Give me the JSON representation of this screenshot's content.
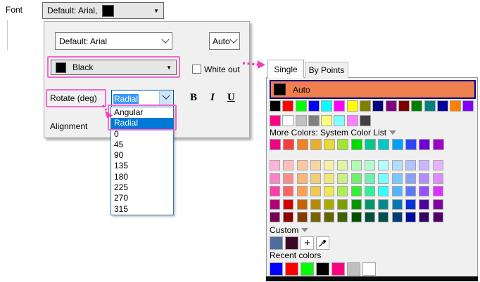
{
  "font_label": "Font",
  "top_dropdown": {
    "text": "Default: Arial,",
    "swatch": "#000000"
  },
  "font_panel": {
    "font_combo": "Default: Arial",
    "size_combo": "Auto",
    "color_combo": "Black",
    "color_swatch": "#000000",
    "white_out_label": "White out",
    "rotate_label": "Rotate (deg)",
    "rotate_value": "Radial",
    "bold_label": "B",
    "italic_label": "I",
    "underline_label": "U",
    "alignment_label": "Alignment"
  },
  "rotate_list": {
    "items": [
      "Angular",
      "Radial",
      "0",
      "45",
      "90",
      "135",
      "180",
      "225",
      "270",
      "315"
    ],
    "selected": "Radial"
  },
  "color_picker": {
    "tab_single": "Single",
    "tab_by_points": "By Points",
    "auto_label": "Auto",
    "auto_bg": "#F08050",
    "auto_swatch": "#000000",
    "basic_row1": [
      "#000000",
      "#FF0000",
      "#00FF00",
      "#0000FF",
      "#00FFFF",
      "#FF00FF",
      "#FFFF00",
      "#808000",
      "#000080",
      "#800080",
      "#800000",
      "#008000",
      "#008080",
      "#0000A0",
      "#FF8000",
      "#8000FF"
    ],
    "basic_row2": [
      "#FF0080",
      "#FFFFFF",
      "#C0C0C0",
      "#808080",
      "#FFFF80",
      "#80FFFF",
      "#FF80FF",
      "#404040"
    ],
    "more_colors_label": "More Colors: System Color List",
    "system_rows": [
      [
        "#F00082",
        "#FA3C3C",
        "#F08228",
        "#E6AF2D",
        "#E6DC32",
        "#A0E632",
        "#00DC00",
        "#00C78C",
        "#00C8C8",
        "#00A0FF",
        "#2846FF",
        "#6E00DC",
        "#A000C8"
      ],
      [
        "#FFB4DC",
        "#FFBEBE",
        "#FAC8A0",
        "#F5D7A5",
        "#F5F0AA",
        "#DCF5AA",
        "#B4FAB4",
        "#B4FAD2",
        "#B4FFFF",
        "#B4DCFF",
        "#B4C3FF",
        "#CCB4FF",
        "#E6B4FF"
      ],
      [
        "#FF82C8",
        "#FF8C8C",
        "#FFB478",
        "#F0CD78",
        "#F0E678",
        "#C8F082",
        "#6EF06E",
        "#6EF0B4",
        "#78FFFF",
        "#78C8FF",
        "#8CA0FF",
        "#B48CFF",
        "#DC8CFF"
      ],
      [
        "#FF3CAA",
        "#FF6464",
        "#FFA050",
        "#F0C850",
        "#F0E650",
        "#AAF050",
        "#32F032",
        "#32F0A0",
        "#32FFFF",
        "#50B4FF",
        "#5A78FF",
        "#9650FF",
        "#DC32FF"
      ],
      [
        "#B40078",
        "#D20000",
        "#C86400",
        "#B48C00",
        "#AAAA00",
        "#78A000",
        "#009600",
        "#00966E",
        "#008C8C",
        "#0078B4",
        "#0032DC",
        "#5000A0",
        "#8200A0"
      ],
      [
        "#780050",
        "#8C0000",
        "#823C00",
        "#786400",
        "#646400",
        "#3C6400",
        "#005000",
        "#00503C",
        "#005050",
        "#003C78",
        "#000A96",
        "#320064",
        "#500064"
      ]
    ],
    "custom_label": "Custom",
    "custom_swatches": [
      "#4E6C9D",
      "#3C0A28"
    ],
    "plus_label": "+",
    "recent_label": "Recent colors",
    "recent_swatches": [
      "#0000FF",
      "#FF0000",
      "#00FF00",
      "#000000",
      "#FF0080",
      "#C0C0C0",
      "#FFFFFF"
    ]
  },
  "accent": {
    "highlight_pink": "#F23CB9",
    "selection_blue": "#0078D7"
  }
}
